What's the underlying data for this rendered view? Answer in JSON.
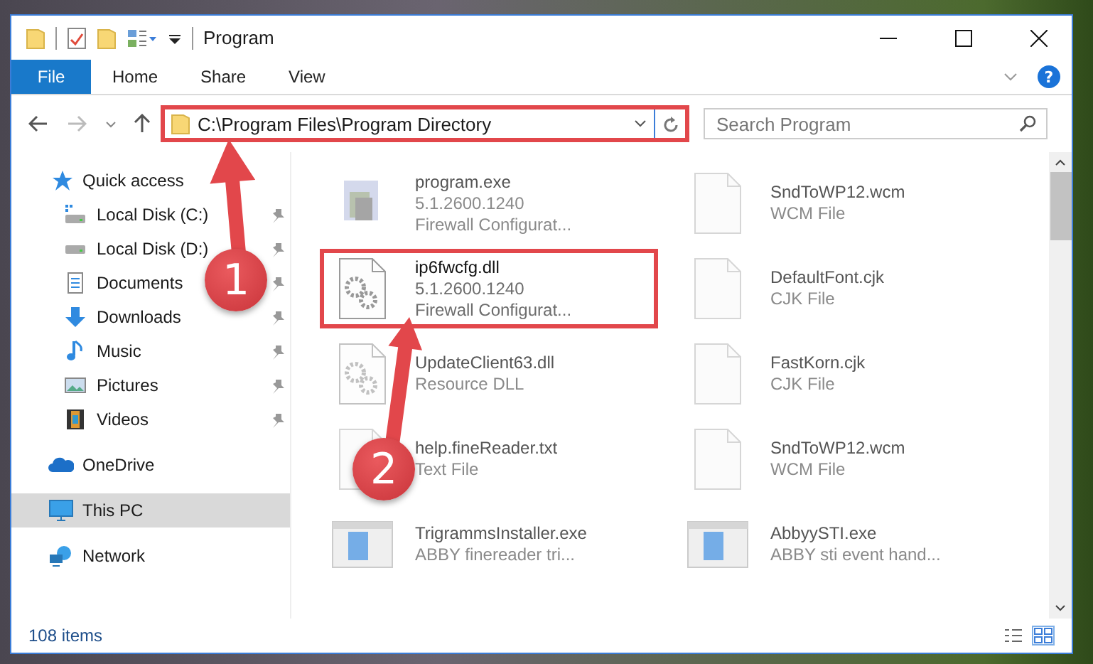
{
  "window": {
    "title": "Program"
  },
  "ribbon": {
    "tabs": [
      {
        "label": "File",
        "selected": true
      },
      {
        "label": "Home",
        "selected": false
      },
      {
        "label": "Share",
        "selected": false
      },
      {
        "label": "View",
        "selected": false
      }
    ],
    "help": "?"
  },
  "address": {
    "path": "C:\\Program Files\\Program Directory",
    "highlighted": true
  },
  "search": {
    "placeholder": "Search Program"
  },
  "sidebar": {
    "items": [
      {
        "label": "Quick access",
        "kind": "star",
        "selected": false,
        "children": [
          {
            "label": "Local Disk (C:)",
            "kind": "system",
            "pinned": true,
            "selected": false
          },
          {
            "label": "Local Disk (D:)",
            "kind": "drive",
            "pinned": true,
            "selected": false
          },
          {
            "label": "Documents",
            "kind": "documents",
            "pinned": true,
            "selected": false
          },
          {
            "label": "Downloads",
            "kind": "downloads",
            "pinned": true,
            "selected": false
          },
          {
            "label": "Music",
            "kind": "music",
            "pinned": true,
            "selected": false
          },
          {
            "label": "Pictures",
            "kind": "pictures",
            "pinned": true,
            "selected": false
          },
          {
            "label": "Videos",
            "kind": "videos",
            "pinned": true,
            "selected": false
          }
        ]
      },
      {
        "label": "OneDrive",
        "kind": "cloud",
        "selected": false
      },
      {
        "label": "This PC",
        "kind": "pc",
        "selected": true
      },
      {
        "label": "Network",
        "kind": "network",
        "selected": false
      }
    ]
  },
  "files": [
    {
      "kind": "exe",
      "name": "program.exe",
      "lines": [
        "5.1.2600.1240",
        "Firewall Configurat..."
      ],
      "blurred": true,
      "highlighted": false
    },
    {
      "kind": "doc",
      "name": "SndToWP12.wcm",
      "lines": [
        "WCM File"
      ],
      "blurred": true,
      "highlighted": false
    },
    {
      "kind": "dll",
      "name": "ip6fwcfg.dll",
      "lines": [
        "5.1.2600.1240",
        "Firewall Configurat..."
      ],
      "blurred": false,
      "highlighted": true
    },
    {
      "kind": "doc",
      "name": "DefaultFont.cjk",
      "lines": [
        "CJK File"
      ],
      "blurred": true,
      "highlighted": false
    },
    {
      "kind": "dll",
      "name": "UpdateClient63.dll",
      "lines": [
        "Resource DLL"
      ],
      "blurred": true,
      "highlighted": false
    },
    {
      "kind": "doc",
      "name": "FastKorn.cjk",
      "lines": [
        "CJK File"
      ],
      "blurred": true,
      "highlighted": false
    },
    {
      "kind": "doc",
      "name": "help.fineReader.txt",
      "lines": [
        "Text File"
      ],
      "blurred": true,
      "highlighted": false
    },
    {
      "kind": "doc",
      "name": "SndToWP12.wcm",
      "lines": [
        "WCM File"
      ],
      "blurred": true,
      "highlighted": false
    },
    {
      "kind": "installer",
      "name": "TrigrammsInstaller.exe",
      "lines": [
        "ABBY finereader tri..."
      ],
      "blurred": true,
      "highlighted": false
    },
    {
      "kind": "installer",
      "name": "AbbyySTI.exe",
      "lines": [
        "ABBY sti event hand..."
      ],
      "blurred": true,
      "highlighted": false
    }
  ],
  "status_bar": {
    "count": "108 items"
  },
  "annotations": [
    {
      "label": "1"
    },
    {
      "label": "2"
    }
  ]
}
